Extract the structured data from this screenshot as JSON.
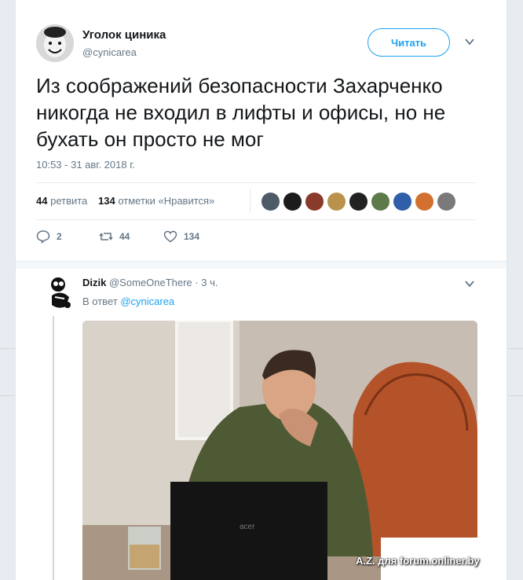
{
  "tweet": {
    "author": {
      "name": "Уголок циника",
      "handle": "@cynicarea"
    },
    "follow_label": "Читать",
    "text": "Из соображений безопасности Захарченко никогда не входил в лифты и офисы, но не бухать он просто не мог",
    "time": "10:53 - 31 авг. 2018 г.",
    "stats": {
      "retweets_count": "44",
      "retweets_label": "ретвита",
      "likes_count": "134",
      "likes_label": "отметки «Нравится»"
    },
    "liker_avatars": [
      "#4d5b68",
      "#1c1c1c",
      "#8a3a2a",
      "#b9924c",
      "#222222",
      "#5d7a4a",
      "#2f5fa8",
      "#d2702f",
      "#7a7a7a"
    ],
    "actions": {
      "replies": "2",
      "retweets": "44",
      "likes": "134"
    }
  },
  "reply": {
    "name": "Dizik",
    "handle": "@SomeOneThere",
    "time": "· 3 ч.",
    "in_reply_prefix": "В ответ",
    "in_reply_mention": "@cynicarea",
    "photo_brand": "acer"
  },
  "watermark": "A.Z. для forum.onliner.by",
  "colors": {
    "accent": "#1da1f2",
    "muted": "#657786",
    "text": "#14171a",
    "background": "#e6ecf0"
  }
}
